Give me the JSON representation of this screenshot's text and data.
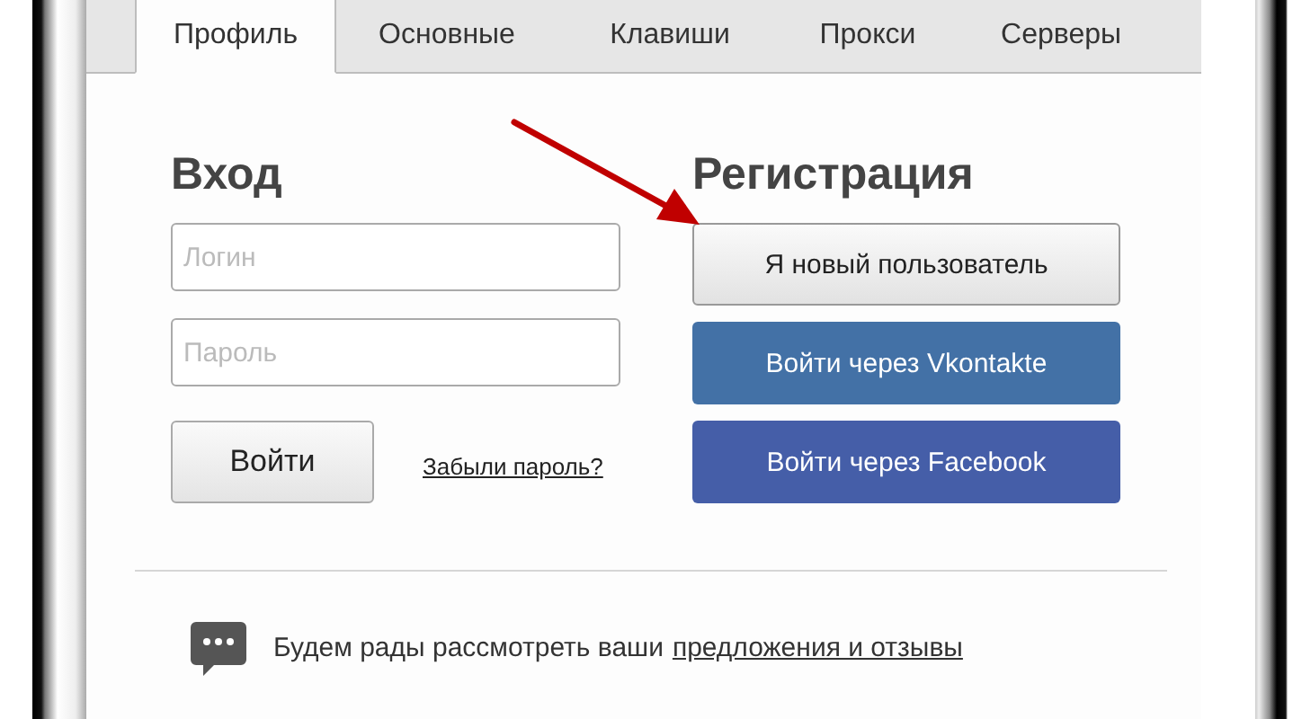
{
  "tabs": [
    {
      "label": "Профиль",
      "selected": true
    },
    {
      "label": "Основные",
      "selected": false
    },
    {
      "label": "Клавиши",
      "selected": false
    },
    {
      "label": "Прокси",
      "selected": false
    },
    {
      "label": "Серверы",
      "selected": false
    }
  ],
  "login": {
    "title": "Вход",
    "login_field": {
      "placeholder": "Логин"
    },
    "password_field": {
      "placeholder": "Пароль"
    },
    "submit": "Войти",
    "forgot_link": "Забыли пароль?"
  },
  "register": {
    "title": "Регистрация",
    "buttons": [
      {
        "kind": "new",
        "label": "Я новый пользователь"
      },
      {
        "kind": "vk",
        "label": "Войти через Vkontakte"
      },
      {
        "kind": "facebook",
        "label": "Войти через Facebook"
      }
    ]
  },
  "feedback": {
    "text": "Будем рады рассмотреть ваши",
    "link": "предложения и отзывы"
  }
}
